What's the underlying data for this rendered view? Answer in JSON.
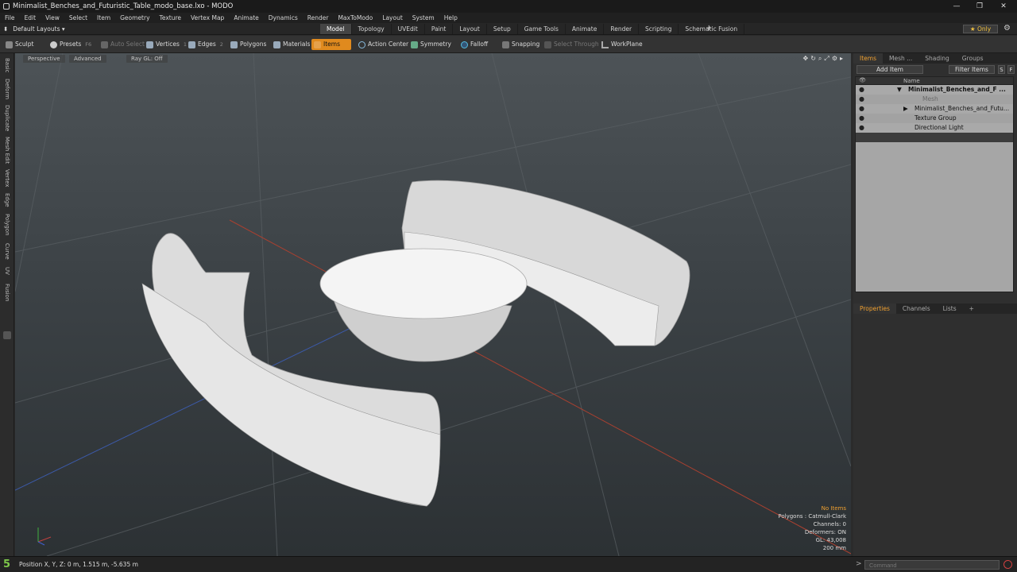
{
  "window": {
    "title": "Minimalist_Benches_and_Futuristic_Table_modo_base.lxo - MODO",
    "controls": [
      "—",
      "❐",
      "✕"
    ]
  },
  "menu": [
    "File",
    "Edit",
    "View",
    "Select",
    "Item",
    "Geometry",
    "Texture",
    "Vertex Map",
    "Animate",
    "Dynamics",
    "Render",
    "MaxToModo",
    "Layout",
    "System",
    "Help"
  ],
  "layouts": {
    "label": "Default Layouts ▾"
  },
  "tabs": [
    "Model",
    "Topology",
    "UVEdit",
    "Paint",
    "Layout",
    "Setup",
    "Game Tools",
    "Animate",
    "Render",
    "Scripting",
    "Schematic Fusion"
  ],
  "active_tab": "Model",
  "only_label": "★ Only",
  "toolbar": {
    "sculpt": "Sculpt",
    "presets": "Presets",
    "presets_key": "F6",
    "auto_select": "Auto Select",
    "vertices": "Vertices",
    "vertices_key": "1",
    "edges": "Edges",
    "edges_key": "2",
    "polygons": "Polygons",
    "materials": "Materials",
    "items": "Items",
    "action_center": "Action Center",
    "symmetry": "Symmetry",
    "falloff": "Falloff",
    "snapping": "Snapping",
    "select_through": "Select Through",
    "workplane": "WorkPlane"
  },
  "left_tabs": [
    "Basic",
    "Deform",
    "Duplicate",
    "Mesh Edit",
    "Vertex",
    "Edge",
    "Polygon",
    "Curve",
    "UV",
    "Fusion"
  ],
  "viewport": {
    "view": "Perspective",
    "advanced": "Advanced",
    "raygl": "Ray GL: Off",
    "info": {
      "no_items": "No Items",
      "polygons": "Polygons : Catmull-Clark",
      "channels": "Channels: 0",
      "deformers": "Deformers: ON",
      "gl": "GL: 43,008",
      "scale": "200 mm"
    }
  },
  "items_panel": {
    "tabs": [
      "Items",
      "Mesh ...",
      "Shading",
      "Groups"
    ],
    "add_item": "Add Item",
    "filter_items": "Filter Items",
    "s": "S",
    "f": "F",
    "name_header": "Name",
    "rows": [
      {
        "label": "Minimalist_Benches_and_F ...",
        "expand": "▼"
      },
      {
        "label": "Mesh",
        "expand": ""
      },
      {
        "label": "Minimalist_Benches_and_Futu...",
        "expand": "▶"
      },
      {
        "label": "Texture Group",
        "expand": ""
      },
      {
        "label": "Directional Light",
        "expand": ""
      }
    ]
  },
  "props_panel": {
    "tabs": [
      "Properties",
      "Channels",
      "Lists",
      "+"
    ]
  },
  "statusbar": {
    "layer": "5",
    "position": "Position X, Y, Z:   0 m, 1.515 m, -5.635 m",
    "command_placeholder": "Command"
  }
}
